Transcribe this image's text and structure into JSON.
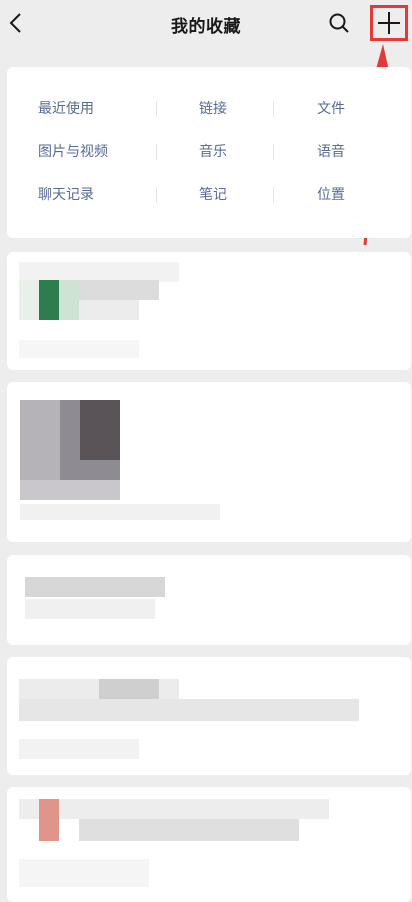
{
  "header": {
    "title": "我的收藏",
    "back_icon": "chevron-left-icon",
    "search_icon": "search-icon",
    "add_icon": "plus-icon"
  },
  "annotation": {
    "color": "#e53935"
  },
  "categories": [
    [
      "最近使用",
      "链接",
      "文件"
    ],
    [
      "图片与视频",
      "音乐",
      "语音"
    ],
    [
      "聊天记录",
      "笔记",
      "位置"
    ]
  ],
  "colors": {
    "link": "#576b95",
    "background": "#ededed",
    "card": "#ffffff"
  }
}
